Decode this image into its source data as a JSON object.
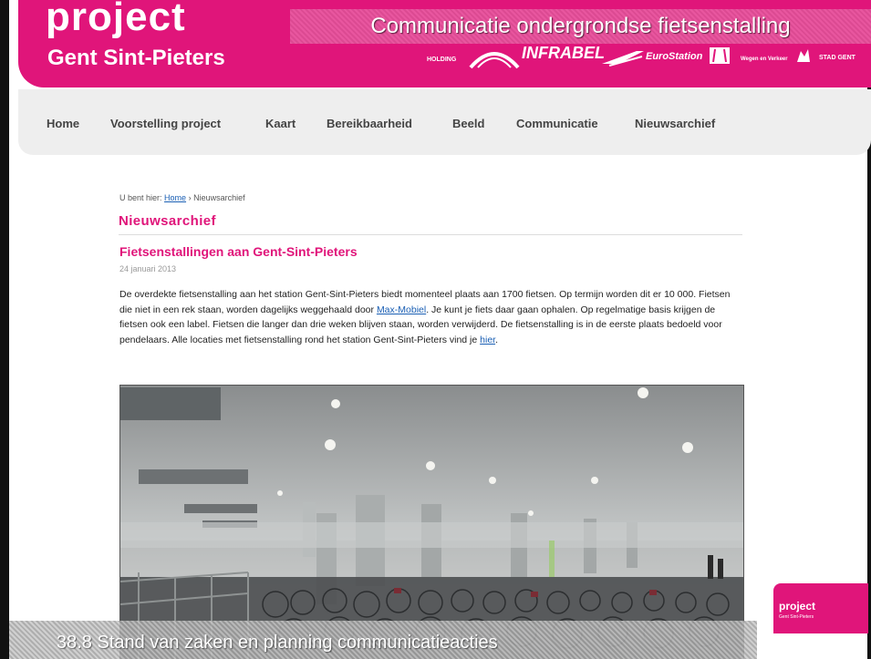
{
  "slide": {
    "title": "Communicatie ondergrondse fietsenstalling",
    "footer": "38.8 Stand van zaken en planning communicatieacties"
  },
  "site": {
    "logo_line1": "project",
    "logo_line2": "Gent Sint-Pieters",
    "partners": [
      "HOLDING",
      "INFRABEL",
      "EuroStation",
      "Wegen en Verkeer",
      "STAD GENT"
    ]
  },
  "nav": {
    "items": [
      "Home",
      "Voorstelling project",
      "Kaart",
      "Bereikbaarheid",
      "Beeld",
      "Communicatie",
      "Nieuwsarchief"
    ]
  },
  "breadcrumb": {
    "prefix": "U bent hier:",
    "home": "Home",
    "separator": "›",
    "current": "Nieuwsarchief"
  },
  "section": {
    "title": "Nieuwsarchief"
  },
  "article": {
    "title": "Fietsenstallingen aan Gent-Sint-Pieters",
    "date": "24 januari 2013",
    "body_part1": "De overdekte fietsenstalling aan het station Gent-Sint-Pieters biedt momenteel plaats aan 1700 fietsen. Op termijn worden dit er 10 000. Fietsen die niet in een rek staan, worden dagelijks weggehaald door ",
    "link_max": "Max-Mobiel",
    "body_part2": ". Je kunt je fiets daar gaan ophalen. Op regelmatige basis krijgen de fietsen ook een label. Fietsen die langer dan drie weken blijven staan, worden verwijderd. De fietsenstalling is in de eerste plaats bedoeld voor pendelaars. Alle locaties met fietsenstalling rond het station Gent-Sint-Pieters vind je ",
    "link_here": "hier",
    "body_end": "."
  },
  "corner_logo": {
    "line1": "project",
    "line2": "Gent Sint-Pieters"
  },
  "colors": {
    "brand": "#e0157a",
    "nav_bg": "#eeeeee",
    "link": "#1a5fb4"
  }
}
